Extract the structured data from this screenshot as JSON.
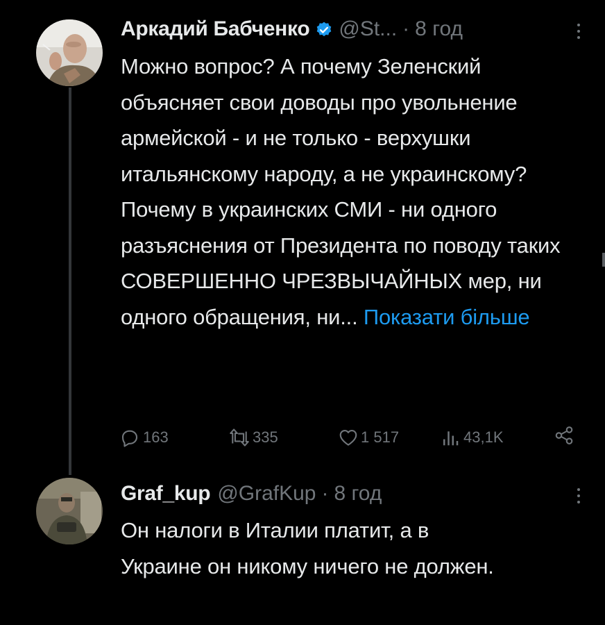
{
  "colors": {
    "background": "#000000",
    "text": "#e7e9ea",
    "muted": "#71767b",
    "link": "#1d9bf0",
    "verified": "#1d9bf0",
    "thread_line": "#333639"
  },
  "tweet1": {
    "display_name": "Аркадий Бабченко",
    "verified_icon": "verified-badge-icon",
    "handle": "@St...",
    "dot": "·",
    "time": "8 год",
    "more_icon": "more-vertical-icon",
    "text_lines": [
      "Можно вопрос? А почему Зеленский объясняет свои доводы про увольнение армейской - и не только - верхушки итальянскому народу, а не украинскому?",
      "Почему в украинских СМИ - ни одного разъяснения от Президента по поводу таких СОВЕРШЕННО ЧРЕЗВЫЧАЙНЫХ мер, ни одного обращения, ни... "
    ],
    "show_more": "Показати більше",
    "actions": {
      "replies": {
        "icon": "reply-icon",
        "count": "163"
      },
      "reposts": {
        "icon": "repost-icon",
        "count": "335"
      },
      "likes": {
        "icon": "heart-icon",
        "count": "1 517"
      },
      "views": {
        "icon": "views-chart-icon",
        "count": "43,1K"
      },
      "share": {
        "icon": "share-icon"
      }
    }
  },
  "tweet2": {
    "display_name": "Graf_kup",
    "handle": "@GrafKup",
    "dot": "·",
    "time": "8 год",
    "more_icon": "more-vertical-icon",
    "text": "Он налоги в Италии платит, а в Украине он никому ничего не должен."
  }
}
